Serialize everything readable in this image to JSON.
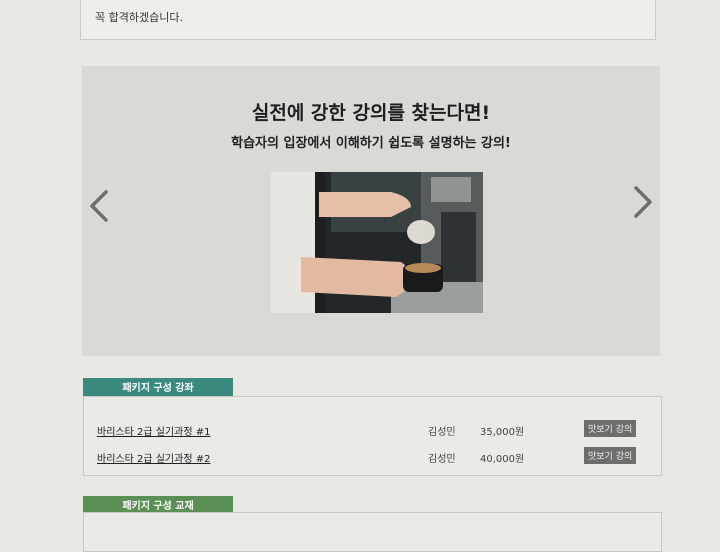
{
  "notice": {
    "text": "꼭 합격하겠습니다."
  },
  "banner": {
    "title": "실전에 강한 강의를 찾는다면!",
    "subtitle": "학습자의 입장에서 이해하기 쉽도록 설명하는 강의!",
    "prev_icon": "chevron-left-icon",
    "next_icon": "chevron-right-icon"
  },
  "courses": {
    "section_label": "패키지 구성 강좌",
    "rows": [
      {
        "name": "바리스타 2급 실기과정 #1",
        "teacher": "김성민",
        "price": "35,000원",
        "preview": "맛보기 강의"
      },
      {
        "name": "바리스타 2급 실기과정 #2",
        "teacher": "김성민",
        "price": "40,000원",
        "preview": "맛보기 강의"
      }
    ]
  },
  "books": {
    "section_label": "패키지 구성 교재"
  },
  "colors": {
    "courses_label": "#3a8a7d",
    "books_label": "#5a8f55",
    "banner_bg": "#d9dad6"
  }
}
